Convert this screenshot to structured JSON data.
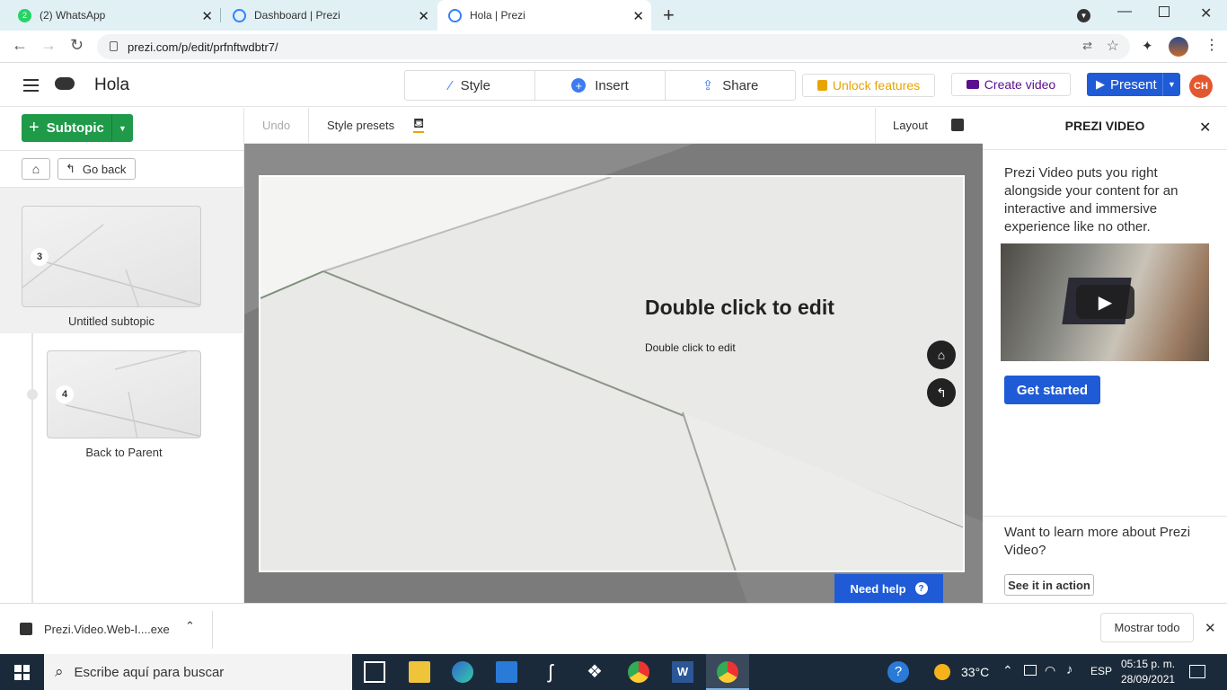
{
  "browser": {
    "tabs": [
      {
        "title": "(2) WhatsApp",
        "icon": "whatsapp-icon"
      },
      {
        "title": "Dashboard | Prezi",
        "icon": "prezi-icon"
      },
      {
        "title": "Hola | Prezi",
        "icon": "prezi-icon"
      }
    ],
    "url": "prezi.com/p/edit/prfnftwdbtr7/"
  },
  "header": {
    "title": "Hola",
    "menu": {
      "style": "Style",
      "insert": "Insert",
      "share": "Share"
    },
    "unlock": "Unlock features",
    "create_video": "Create video",
    "present": "Present",
    "avatar": "CH"
  },
  "sidebar": {
    "subtopic_button": "Subtopic",
    "go_back": "Go back",
    "items": [
      {
        "number": "3",
        "label": "Untitled subtopic"
      },
      {
        "number": "4",
        "label": "Back to Parent"
      }
    ]
  },
  "toolbar": {
    "undo": "Undo",
    "style_presets": "Style presets",
    "layout": "Layout"
  },
  "slide": {
    "title": "Double click to edit",
    "subtitle": "Double click to edit"
  },
  "help": {
    "label": "Need help",
    "q": "?"
  },
  "panel": {
    "title": "PREZI VIDEO",
    "description": "Prezi Video puts you right alongside your content for an interactive and immersive experience like no other.",
    "cta": "Get started",
    "learn_more": "Want to learn more about Prezi Video?",
    "see_in_action": "See it in action"
  },
  "downloads": {
    "file": "Prezi.Video.Web-I....exe",
    "show_all": "Mostrar todo"
  },
  "taskbar": {
    "search_placeholder": "Escribe aquí para buscar",
    "weather": "33°C",
    "lang": "ESP",
    "time": "05:15 p. m.",
    "date": "28/09/2021"
  },
  "colors": {
    "green": "#1f9a49",
    "blue": "#1f5bd6",
    "unlock": "#e8a400",
    "video_purple": "#5a0f8e",
    "avatar": "#e4572e"
  }
}
